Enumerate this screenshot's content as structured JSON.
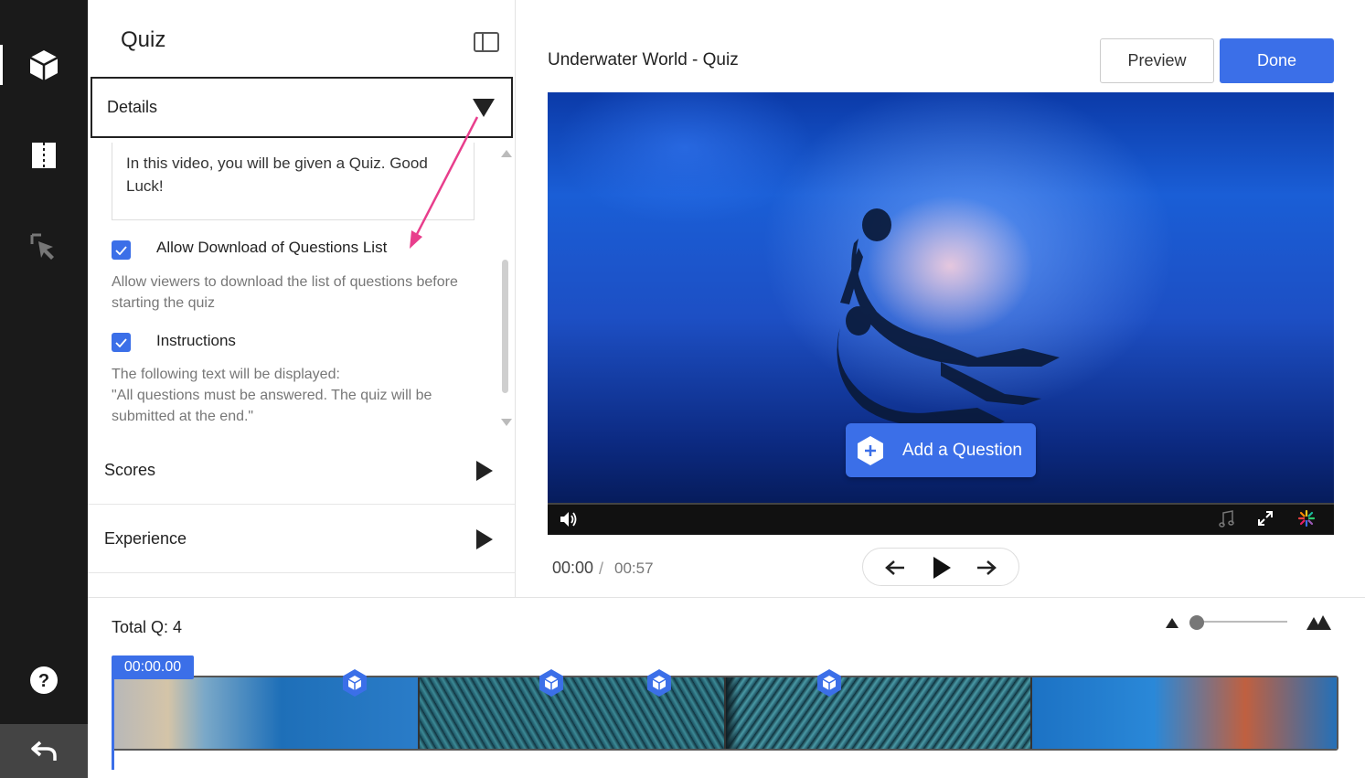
{
  "rail": {
    "items": [
      {
        "name": "cube-icon"
      },
      {
        "name": "book-icon"
      },
      {
        "name": "cursor-click-icon"
      }
    ],
    "help_icon": "question-circle-icon",
    "back_icon": "undo-arrow-icon"
  },
  "panel": {
    "title": "Quiz",
    "details": {
      "label": "Details",
      "description_text": "In this video, you will be given a Quiz. Good Luck!",
      "allow_download": {
        "label": "Allow Download of Questions List",
        "checked": true,
        "help": "Allow viewers to download the list of questions before starting the quiz"
      },
      "instructions": {
        "label": "Instructions",
        "checked": true,
        "help_line1": "The following text will be displayed:",
        "help_line2": "\"All questions must be answered. The quiz will be submitted at the end.\""
      }
    },
    "sections": [
      {
        "label": "Scores"
      },
      {
        "label": "Experience"
      }
    ]
  },
  "main": {
    "video_title": "Underwater World - Quiz",
    "preview_label": "Preview",
    "done_label": "Done",
    "add_question_label": "Add a Question",
    "time_current": "00:00",
    "time_separator": "/",
    "time_total": "00:57"
  },
  "timeline": {
    "total_q": "Total Q: 4",
    "playhead_time": "00:00.00",
    "accent": "#3b6fe8"
  }
}
